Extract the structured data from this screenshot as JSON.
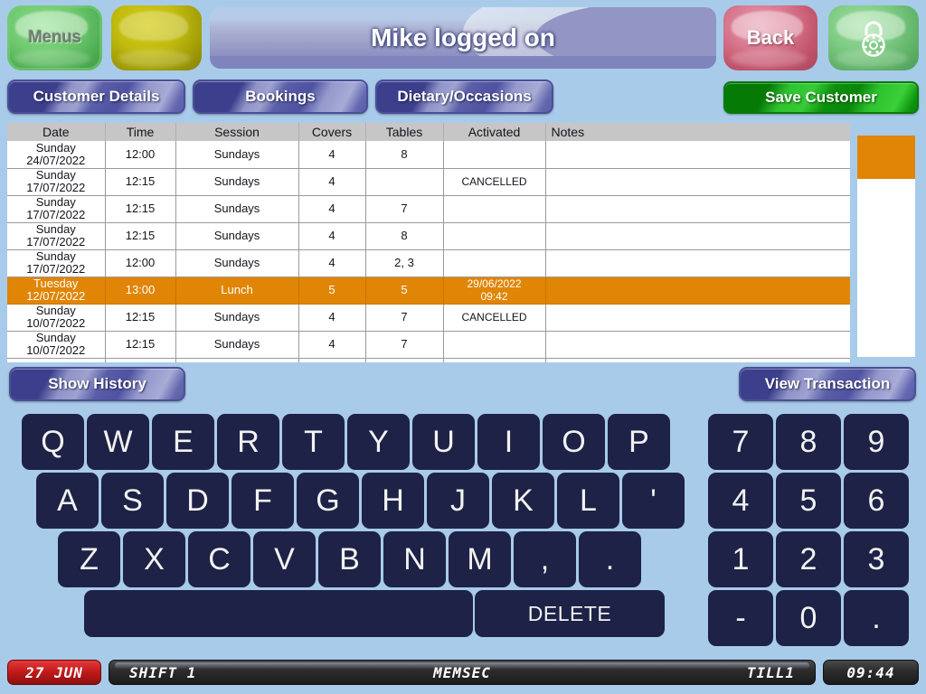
{
  "header": {
    "menus_label": "Menus",
    "title": "Mike logged on",
    "back_label": "Back",
    "lock_icon": "padlock-icon",
    "blank_button_label": ""
  },
  "tabs": [
    {
      "label": "Customer Details",
      "name": "tab-customer-details"
    },
    {
      "label": "Bookings",
      "name": "tab-bookings"
    },
    {
      "label": "Dietary/Occasions",
      "name": "tab-dietary-occasions"
    }
  ],
  "actions": {
    "save_customer_label": "Save Customer",
    "show_history_label": "Show History",
    "view_transaction_label": "View Transaction"
  },
  "bookings_table": {
    "columns": [
      "Date",
      "Time",
      "Session",
      "Covers",
      "Tables",
      "Activated",
      "Notes"
    ],
    "rows": [
      {
        "day": "Sunday",
        "date": "24/07/2022",
        "time": "12:00",
        "session": "Sundays",
        "covers": "4",
        "tables": "8",
        "activated_1": "",
        "activated_2": "",
        "notes": "",
        "selected": false
      },
      {
        "day": "Sunday",
        "date": "17/07/2022",
        "time": "12:15",
        "session": "Sundays",
        "covers": "4",
        "tables": "",
        "activated_1": "CANCELLED",
        "activated_2": "",
        "notes": "",
        "selected": false
      },
      {
        "day": "Sunday",
        "date": "17/07/2022",
        "time": "12:15",
        "session": "Sundays",
        "covers": "4",
        "tables": "7",
        "activated_1": "",
        "activated_2": "",
        "notes": "",
        "selected": false
      },
      {
        "day": "Sunday",
        "date": "17/07/2022",
        "time": "12:15",
        "session": "Sundays",
        "covers": "4",
        "tables": "8",
        "activated_1": "",
        "activated_2": "",
        "notes": "",
        "selected": false
      },
      {
        "day": "Sunday",
        "date": "17/07/2022",
        "time": "12:00",
        "session": "Sundays",
        "covers": "4",
        "tables": "2, 3",
        "activated_1": "",
        "activated_2": "",
        "notes": "",
        "selected": false
      },
      {
        "day": "Tuesday",
        "date": "12/07/2022",
        "time": "13:00",
        "session": "Lunch",
        "covers": "5",
        "tables": "5",
        "activated_1": "29/06/2022",
        "activated_2": "09:42",
        "notes": "",
        "selected": true
      },
      {
        "day": "Sunday",
        "date": "10/07/2022",
        "time": "12:15",
        "session": "Sundays",
        "covers": "4",
        "tables": "7",
        "activated_1": "CANCELLED",
        "activated_2": "",
        "notes": "",
        "selected": false
      },
      {
        "day": "Sunday",
        "date": "10/07/2022",
        "time": "12:15",
        "session": "Sundays",
        "covers": "4",
        "tables": "7",
        "activated_1": "",
        "activated_2": "",
        "notes": "",
        "selected": false
      },
      {
        "day": "Sunday",
        "date": "",
        "time": "",
        "session": "",
        "covers": "",
        "tables": "",
        "activated_1": "",
        "activated_2": "",
        "notes": "",
        "selected": false
      }
    ],
    "selected_row_color": "#e08505",
    "header_color": "#c6c6c6"
  },
  "keyboard": {
    "row1": [
      "Q",
      "W",
      "E",
      "R",
      "T",
      "Y",
      "U",
      "I",
      "O",
      "P"
    ],
    "row2": [
      "A",
      "S",
      "D",
      "F",
      "G",
      "H",
      "J",
      "K",
      "L",
      "'"
    ],
    "row3": [
      "Z",
      "X",
      "C",
      "V",
      "B",
      "N",
      "M",
      ",",
      "."
    ],
    "space_label": "",
    "delete_label": "DELETE"
  },
  "numpad": {
    "keys": [
      "7",
      "8",
      "9",
      "4",
      "5",
      "6",
      "1",
      "2",
      "3",
      "-",
      "0",
      "."
    ]
  },
  "status_bar": {
    "date": "27 JUN",
    "shift": "SHIFT 1",
    "operator": "MEMSEC",
    "till": "TILL1",
    "time": "09:44"
  }
}
